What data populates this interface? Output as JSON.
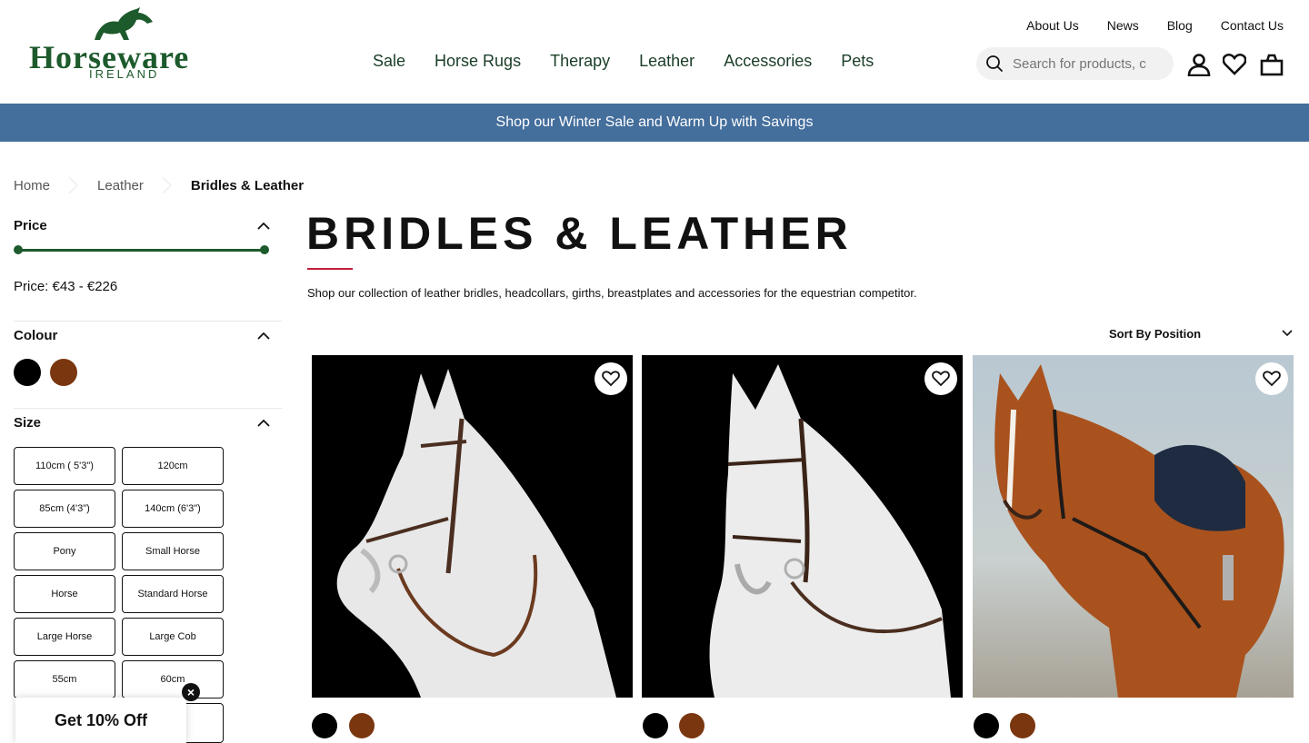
{
  "brand": {
    "name": "Horseware",
    "sub": "IRELAND",
    "color": "#1d5a2c"
  },
  "toplinks": [
    "About Us",
    "News",
    "Blog",
    "Contact Us"
  ],
  "nav": [
    "Sale",
    "Horse Rugs",
    "Therapy",
    "Leather",
    "Accessories",
    "Pets"
  ],
  "search": {
    "placeholder": "Search for products, c",
    "icon": "search-icon"
  },
  "header_icons": [
    "account-icon",
    "wishlist-icon",
    "bag-icon"
  ],
  "promo": {
    "text": "Shop our Winter Sale and Warm Up with Savings",
    "color": "#446e9c"
  },
  "breadcrumb": [
    "Home",
    "Leather",
    "Bridles & Leather"
  ],
  "filters": {
    "price": {
      "title": "Price",
      "text": "Price: €43 - €226",
      "min": 43,
      "max": 226
    },
    "colour": {
      "title": "Colour",
      "swatches": [
        "#000000",
        "#7a360f"
      ]
    },
    "size": {
      "title": "Size",
      "options": [
        "110cm ( 5'3\")",
        "120cm",
        "85cm (4'3\")",
        "140cm (6'3\")",
        "Pony",
        "Small Horse",
        "Horse",
        "Standard Horse",
        "Large Horse",
        "Large Cob",
        "55cm",
        "60cm"
      ]
    }
  },
  "page": {
    "title": "BRIDLES & LEATHER",
    "description": "Shop our collection of leather bridles, headcollars, girths, breastplates and accessories for the equestrian competitor.",
    "sort_label": "Sort By Position"
  },
  "products": [
    {
      "image": "grey-horse-bridle-black-background",
      "swatches": [
        "#000000",
        "#7a360f"
      ]
    },
    {
      "image": "grey-horse-bridle-front-black-background",
      "swatches": [
        "#000000",
        "#7a360f"
      ]
    },
    {
      "image": "chestnut-horse-saddle-outdoor",
      "swatches": [
        "#000000",
        "#7a360f"
      ]
    }
  ],
  "popup": {
    "label": "Get 10% Off"
  },
  "accent": "#c41e3a"
}
